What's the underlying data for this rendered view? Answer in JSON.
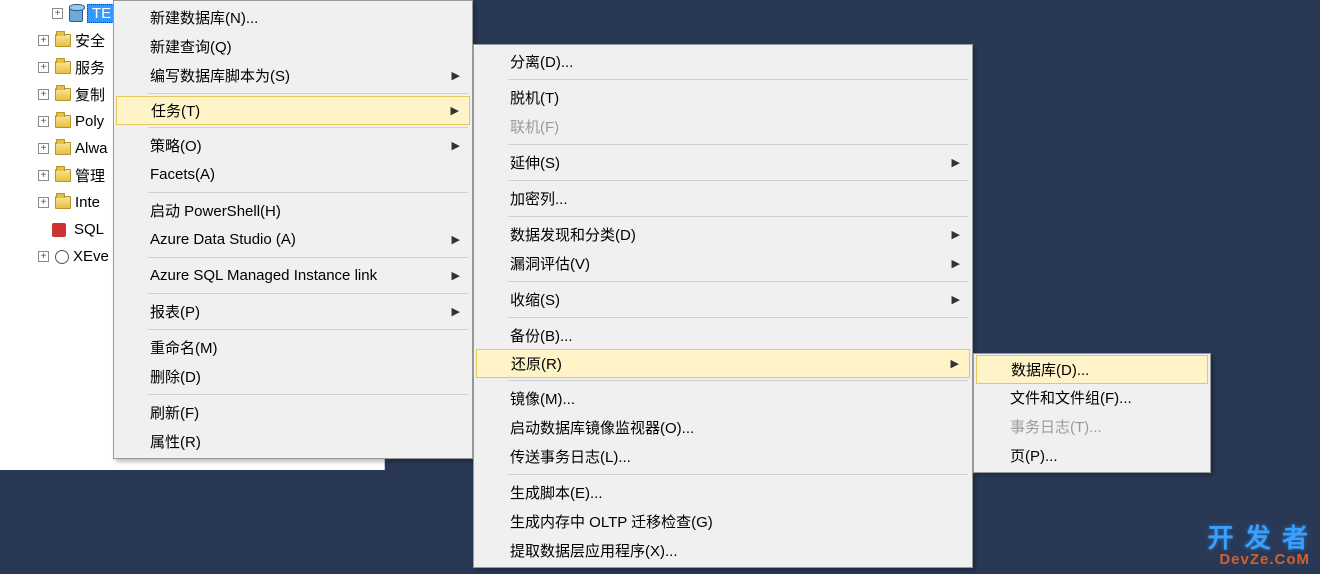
{
  "tree": {
    "selected_db": "TE",
    "items": [
      {
        "label": "安全"
      },
      {
        "label": "服务"
      },
      {
        "label": "复制"
      },
      {
        "label": "Poly"
      },
      {
        "label": "Alwa"
      },
      {
        "label": "管理"
      },
      {
        "label": "Inte"
      }
    ],
    "sql_label": "SQL",
    "xe_label": "XEve"
  },
  "menu1": {
    "new_db": "新建数据库(N)...",
    "new_query": "新建查询(Q)",
    "script_as": "编写数据库脚本为(S)",
    "tasks": "任务(T)",
    "policy": "策略(O)",
    "facets": "Facets(A)",
    "powershell": "启动 PowerShell(H)",
    "azure_ds": "Azure Data Studio (A)",
    "azure_mi": "Azure SQL Managed Instance link",
    "reports": "报表(P)",
    "rename": "重命名(M)",
    "delete": "删除(D)",
    "refresh": "刷新(F)",
    "properties": "属性(R)"
  },
  "menu2": {
    "detach": "分离(D)...",
    "offline": "脱机(T)",
    "online": "联机(F)",
    "stretch": "延伸(S)",
    "encrypt": "加密列...",
    "discovery": "数据发现和分类(D)",
    "vuln": "漏洞评估(V)",
    "shrink": "收缩(S)",
    "backup": "备份(B)...",
    "restore": "还原(R)",
    "mirror": "镜像(M)...",
    "launch_mon": "启动数据库镜像监视器(O)...",
    "ship_log": "传送事务日志(L)...",
    "gen_script": "生成脚本(E)...",
    "oltp": "生成内存中 OLTP 迁移检查(G)",
    "extract": "提取数据层应用程序(X)..."
  },
  "menu3": {
    "database": "数据库(D)...",
    "files": "文件和文件组(F)...",
    "txlog": "事务日志(T)...",
    "page": "页(P)..."
  },
  "watermark": {
    "top": "开 发 者",
    "bottom": "DevZe.CoM"
  }
}
